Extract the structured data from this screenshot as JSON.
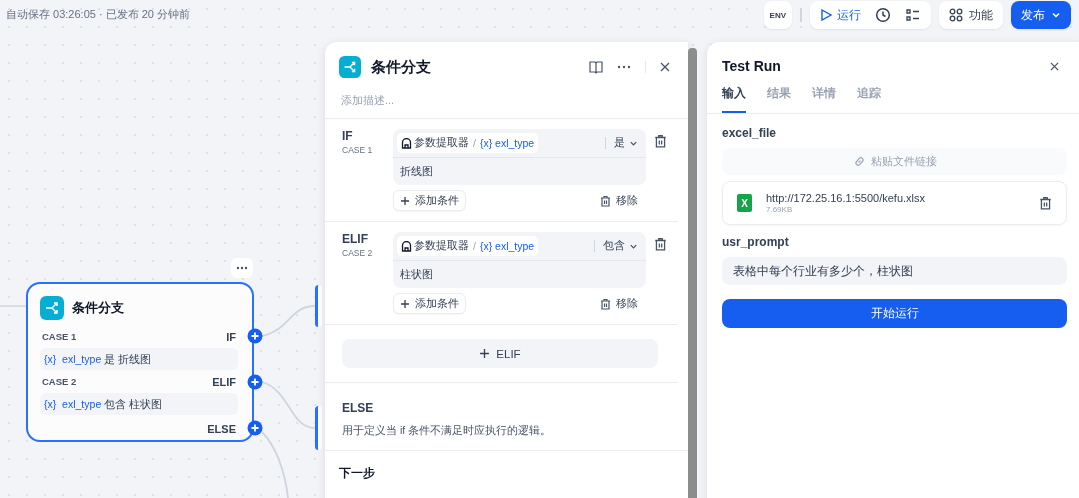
{
  "status": "自动保存 03:26:05 · 已发布 20 分钟前",
  "toolbar": {
    "env": "ENV",
    "run": "运行",
    "features": "功能",
    "publish": "发布"
  },
  "canvas_node": {
    "title": "条件分支",
    "cases": [
      {
        "label": "CASE 1",
        "port": "IF",
        "var": "{x}",
        "field": "exl_type",
        "op": "是",
        "value": "折线图"
      },
      {
        "label": "CASE 2",
        "port": "ELIF",
        "var": "{x}",
        "field": "exl_type",
        "op": "包含",
        "value": "柱状图"
      }
    ],
    "else_port": "ELSE"
  },
  "panel": {
    "title": "条件分支",
    "description_placeholder": "添加描述...",
    "cases": [
      {
        "branch": "IF",
        "label": "CASE 1",
        "source": "参数提取器",
        "separator": "/",
        "var": "{x}",
        "field": "exl_type",
        "operator": "是",
        "value": "折线图",
        "add": "添加条件",
        "remove": "移除"
      },
      {
        "branch": "ELIF",
        "label": "CASE 2",
        "source": "参数提取器",
        "separator": "/",
        "var": "{x}",
        "field": "exl_type",
        "operator": "包含",
        "value": "柱状图",
        "add": "添加条件",
        "remove": "移除"
      }
    ],
    "add_elif": "ELIF",
    "else_title": "ELSE",
    "else_text": "用于定义当 if 条件不满足时应执行的逻辑。",
    "next_title": "下一步"
  },
  "test_run": {
    "title": "Test Run",
    "tabs": [
      {
        "label": "输入",
        "selected": true
      },
      {
        "label": "结果",
        "selected": false
      },
      {
        "label": "详情",
        "selected": false
      },
      {
        "label": "追踪",
        "selected": false
      }
    ],
    "fields": [
      {
        "kind": "file",
        "label": "excel_file",
        "paste_placeholder": "粘贴文件链接",
        "badge": "X",
        "file_name": "http://172.25.16.1:5500/kefu.xlsx",
        "file_size": "7.69KB"
      },
      {
        "kind": "text",
        "label": "usr_prompt",
        "value": "表格中每个行业有多少个，柱状图"
      }
    ],
    "run_button": "开始运行"
  }
}
